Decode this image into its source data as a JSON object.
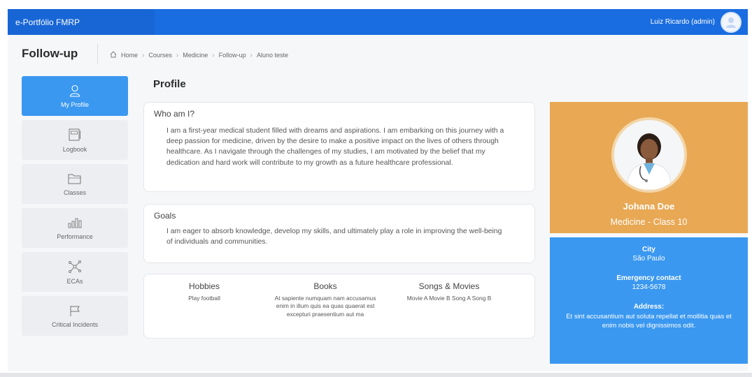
{
  "app": {
    "brand": "e-Portfólio FMRP",
    "user_name": "Luiz Ricardo (admin)"
  },
  "page": {
    "title": "Follow-up",
    "breadcrumb": [
      "Home",
      "Courses",
      "Medicine",
      "Follow-up",
      "Aluno teste"
    ]
  },
  "sidebar": {
    "items": [
      {
        "label": "My Profile",
        "icon": "user-icon",
        "active": true
      },
      {
        "label": "Logbook",
        "icon": "logbook-icon",
        "active": false
      },
      {
        "label": "Classes",
        "icon": "folder-icon",
        "active": false
      },
      {
        "label": "Performance",
        "icon": "bar-chart-icon",
        "active": false
      },
      {
        "label": "ECAs",
        "icon": "network-icon",
        "active": false
      },
      {
        "label": "Critical Incidents",
        "icon": "flag-icon",
        "active": false
      }
    ]
  },
  "profile": {
    "heading": "Profile",
    "who_title": "Who am I?",
    "who_text": "I am a first-year medical student filled with dreams and aspirations. I am embarking on this journey with a deep passion for medicine, driven by the desire to make a positive impact on the lives of others through healthcare. As I navigate through the challenges of my studies, I am motivated by the belief that my dedication and hard work will contribute to my growth as a future healthcare professional.",
    "goals_title": "Goals",
    "goals_text": "I am eager to absorb knowledge, develop my skills, and ultimately play a role in improving the well-being of individuals and communities.",
    "hobbies_title": "Hobbies",
    "hobbies_text": "Play football",
    "books_title": "Books",
    "books_text": "At sapiente numquam nam accusamus enim in illum quis ea quas quaerat est excepturi praesentium aut ma",
    "songs_title": "Songs & Movies",
    "songs_text": "Movie A Movie B Song A Song B"
  },
  "student": {
    "name": "Johana Doe",
    "class": "Medicine - Class 10",
    "city_label": "City",
    "city": "São Paulo",
    "emergency_label": "Emergency contact",
    "emergency": "1234-5678",
    "address_label": "Address:",
    "address": "Et sint accusantium aut soluta repellat et mollitia quas et enim nobis vel dignissimos odit."
  },
  "colors": {
    "topbar": "#1a6de0",
    "accent": "#3a98f0",
    "profile_card": "#e8a854"
  }
}
